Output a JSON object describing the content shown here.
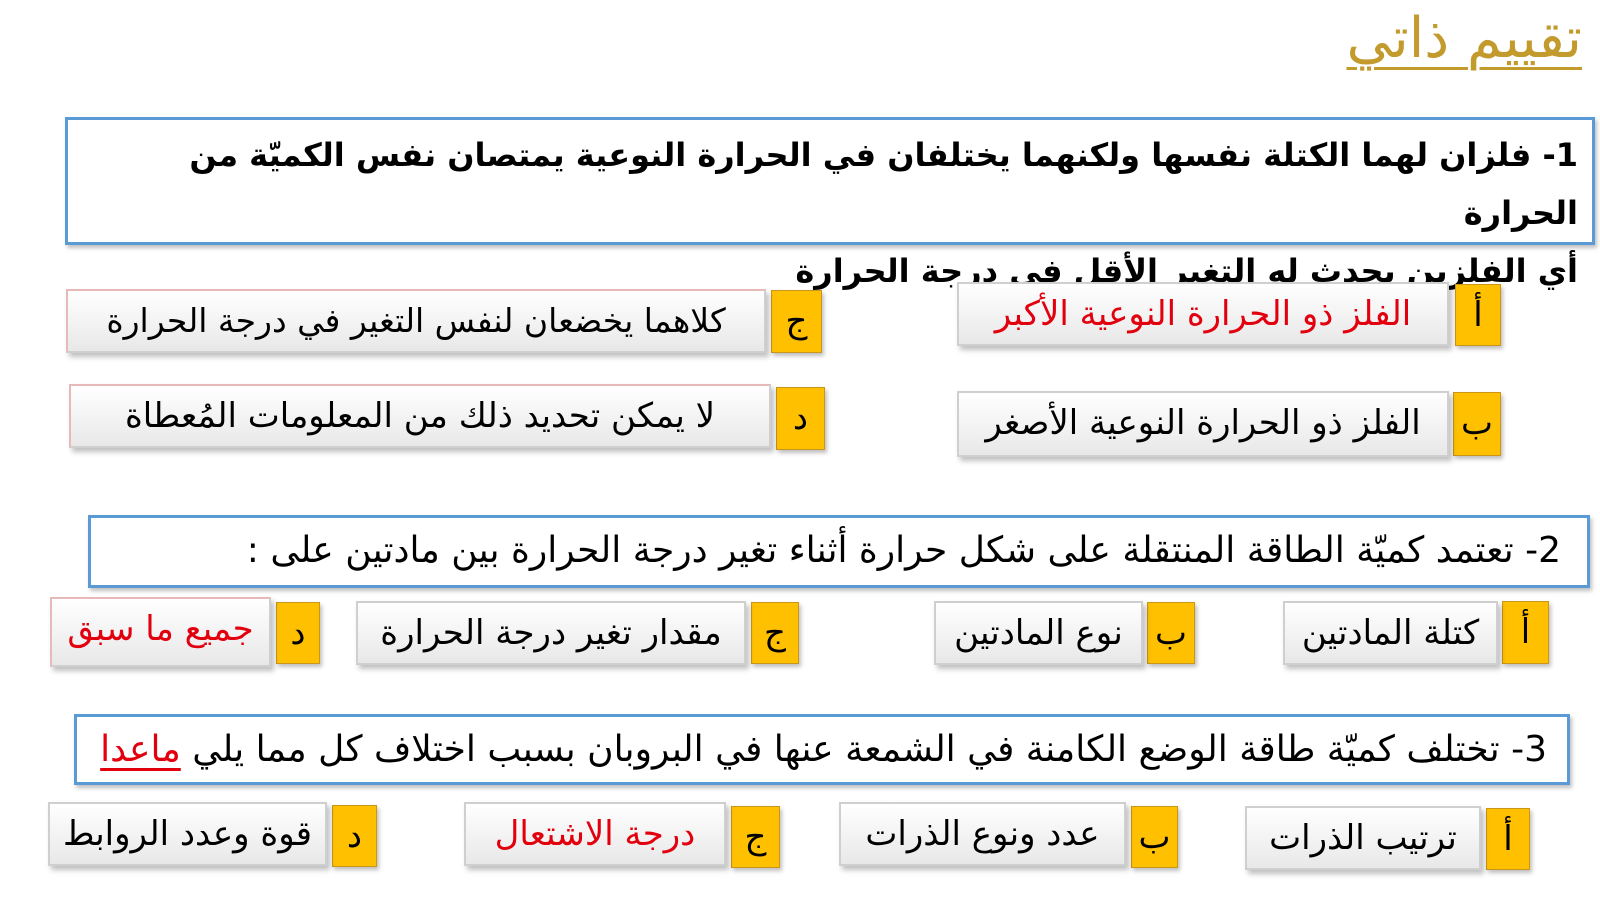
{
  "title": "تقييم ذاتي",
  "q1": {
    "line1": "1- فلزان لهما الكتلة نفسها ولكنهما يختلفان في الحرارة النوعية يمتصان نفس الكميّة من الحرارة",
    "line2": "أي الفلزين يحدث له التغير الأقل في درجة الحرارة",
    "options": {
      "a": {
        "letter": "أ",
        "text": "الفلز ذو الحرارة النوعية الأكبر"
      },
      "b": {
        "letter": "ب",
        "text": "الفلز ذو الحرارة النوعية الأصغر"
      },
      "c": {
        "letter": "ج",
        "text": "كلاهما يخضعان لنفس التغير في درجة الحرارة"
      },
      "d": {
        "letter": "د",
        "text": "لا يمكن تحديد ذلك من المعلومات المُعطاة"
      }
    }
  },
  "q2": {
    "text": "2- تعتمد كميّة الطاقة المنتقلة على شكل حرارة أثناء تغير درجة الحرارة بين مادتين على :",
    "options": {
      "a": {
        "letter": "أ",
        "text": "كتلة المادتين"
      },
      "b": {
        "letter": "ب",
        "text": "نوع المادتين"
      },
      "c": {
        "letter": "ج",
        "text": "مقدار تغير درجة الحرارة"
      },
      "d": {
        "letter": "د",
        "text": "جميع ما سبق"
      }
    }
  },
  "q3": {
    "text": "3- تختلف كميّة طاقة الوضع الكامنة في الشمعة عنها في البروبان بسبب اختلاف كل مما يلي",
    "highlight": "ماعدا",
    "options": {
      "a": {
        "letter": "أ",
        "text": "ترتيب الذرات"
      },
      "b": {
        "letter": "ب",
        "text": "عدد ونوع الذرات"
      },
      "c": {
        "letter": "ج",
        "text": "درجة الاشتعال"
      },
      "d": {
        "letter": "د",
        "text": "قوة وعدد الروابط"
      }
    }
  },
  "colors": {
    "accent_gold": "#c39a2c",
    "tag_yellow": "#ffc000",
    "question_border": "#5b9bd5",
    "answer_red": "#e2000e"
  }
}
